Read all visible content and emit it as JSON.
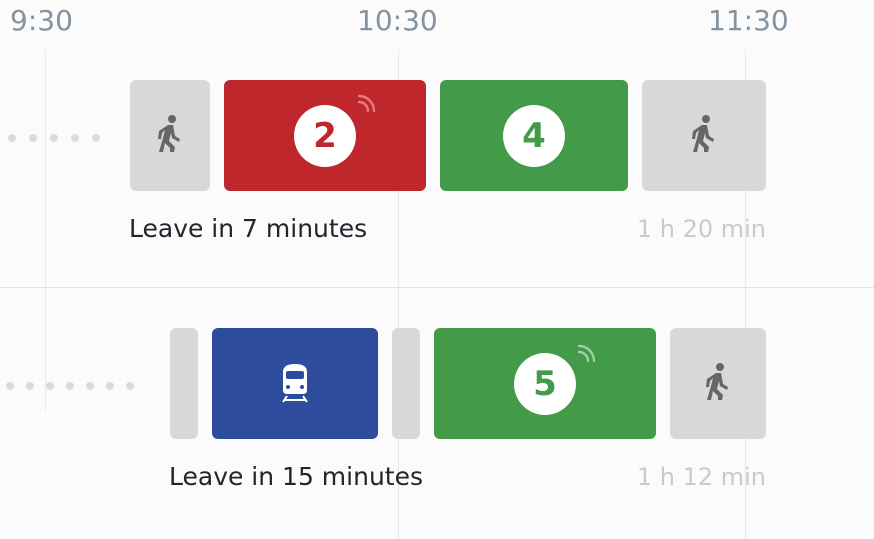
{
  "timeline": {
    "labels": [
      "9:30",
      "10:30",
      "11:30"
    ]
  },
  "routes": [
    {
      "leave_text": "Leave in 7 minutes",
      "duration": "1 h 20 min",
      "segments": [
        {
          "type": "walk",
          "icon": "walk-icon"
        },
        {
          "type": "bus",
          "line": "2",
          "color": "#c0272d",
          "realtime": true
        },
        {
          "type": "bus",
          "line": "4",
          "color": "#439a48",
          "realtime": false
        },
        {
          "type": "walk",
          "icon": "walk-icon"
        }
      ]
    },
    {
      "leave_text": "Leave in 15 minutes",
      "duration": "1 h 12 min",
      "segments": [
        {
          "type": "transfer"
        },
        {
          "type": "train",
          "icon": "train-icon",
          "color": "#2d4d9c"
        },
        {
          "type": "transfer"
        },
        {
          "type": "bus",
          "line": "5",
          "color": "#439a48",
          "realtime": true
        },
        {
          "type": "walk",
          "icon": "walk-icon"
        }
      ]
    }
  ]
}
